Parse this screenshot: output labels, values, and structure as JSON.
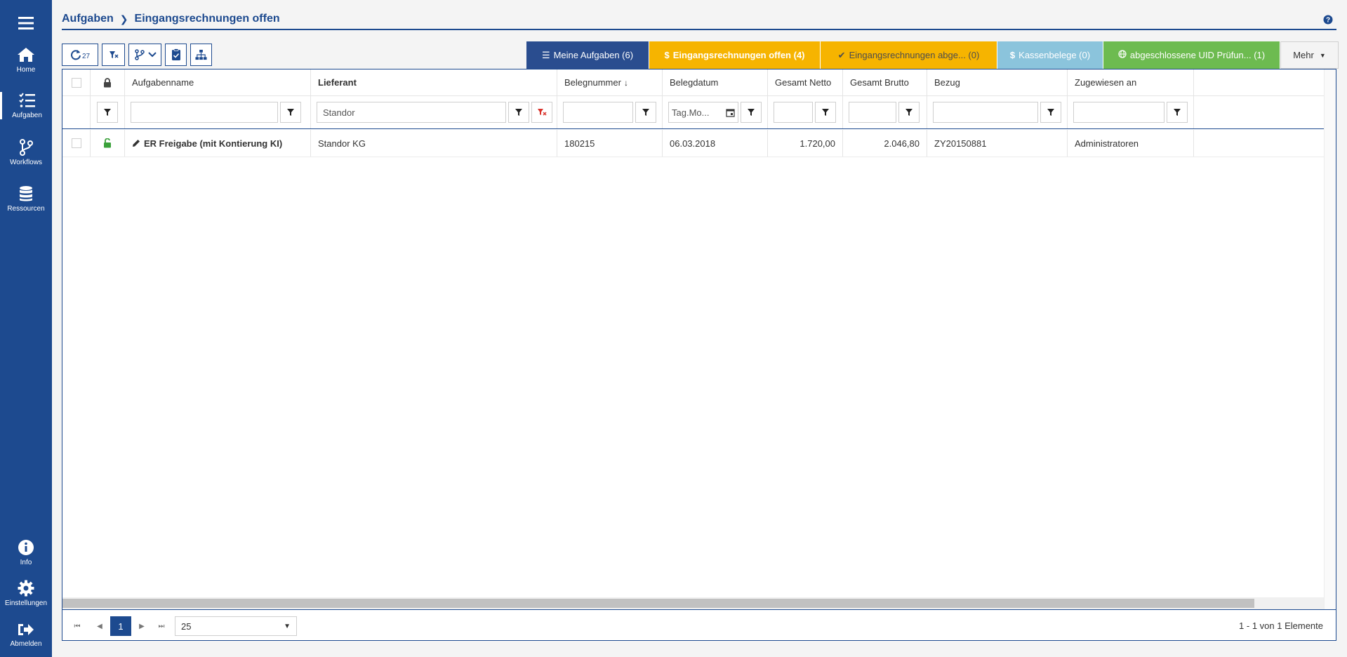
{
  "sidebar": {
    "items": [
      {
        "label": "Home",
        "icon": "home-icon"
      },
      {
        "label": "Aufgaben",
        "icon": "tasks-icon"
      },
      {
        "label": "Workflows",
        "icon": "workflow-icon"
      },
      {
        "label": "Ressourcen",
        "icon": "database-icon"
      }
    ],
    "bottom": [
      {
        "label": "Info",
        "icon": "info-icon"
      },
      {
        "label": "Einstellungen",
        "icon": "gear-icon"
      },
      {
        "label": "Abmelden",
        "icon": "logout-icon"
      }
    ]
  },
  "breadcrumb": {
    "root": "Aufgaben",
    "current": "Eingangsrechnungen offen"
  },
  "toolbar": {
    "refresh_count": "27"
  },
  "queue_tabs": [
    {
      "icon": "list-icon",
      "label": "Meine Aufgaben (6)",
      "bg": "#2a4d8f",
      "color": "#ffffff",
      "bold": false
    },
    {
      "icon": "dollar-icon",
      "label": "Eingangsrechnungen offen (4)",
      "bg": "#f6b400",
      "color": "#ffffff",
      "bold": true
    },
    {
      "icon": "check-icon",
      "label": "Eingangsrechnungen abge...  (0)",
      "bg": "#f6b400",
      "color": "#4d4d4d",
      "bold": false
    },
    {
      "icon": "dollar-icon",
      "label": "Kassenbelege (0)",
      "bg": "#8bc4dc",
      "color": "#ffffff",
      "bold": false
    },
    {
      "icon": "globe-icon",
      "label": "abgeschlossene UID Prüfun... (1)",
      "bg": "#6dbb50",
      "color": "#ffffff",
      "bold": false
    },
    {
      "icon": "caret-down-icon",
      "label": "Mehr",
      "bg": "#f4f4f4",
      "color": "#333333",
      "bold": false
    }
  ],
  "columns": {
    "aufgabenname": "Aufgabenname",
    "lieferant": "Lieferant",
    "belegnummer": "Belegnummer",
    "belegdatum": "Belegdatum",
    "gesamt_netto": "Gesamt Netto",
    "gesamt_brutto": "Gesamt Brutto",
    "bezug": "Bezug",
    "zugewiesen": "Zugewiesen an"
  },
  "filters": {
    "aufgabenname": "",
    "lieferant": "Standor",
    "belegnummer": "",
    "belegdatum_placeholder": "Tag.Mo...",
    "gesamt_netto": "",
    "gesamt_brutto": "",
    "bezug": "",
    "zugewiesen": ""
  },
  "rows": [
    {
      "aufgabenname": "ER Freigabe (mit Kontierung KI)",
      "lieferant": "Standor KG",
      "belegnummer": "180215",
      "belegdatum": "06.03.2018",
      "gesamt_netto": "1.720,00",
      "gesamt_brutto": "2.046,80",
      "bezug": "ZY20150881",
      "zugewiesen": "Administratoren"
    }
  ],
  "pager": {
    "current_page": "1",
    "page_size": "25",
    "info": "1 - 1 von 1 Elemente"
  },
  "colors": {
    "primary": "#1d4a8f",
    "unlocked": "#3aa13a",
    "filter_clear": "#d9322b"
  }
}
